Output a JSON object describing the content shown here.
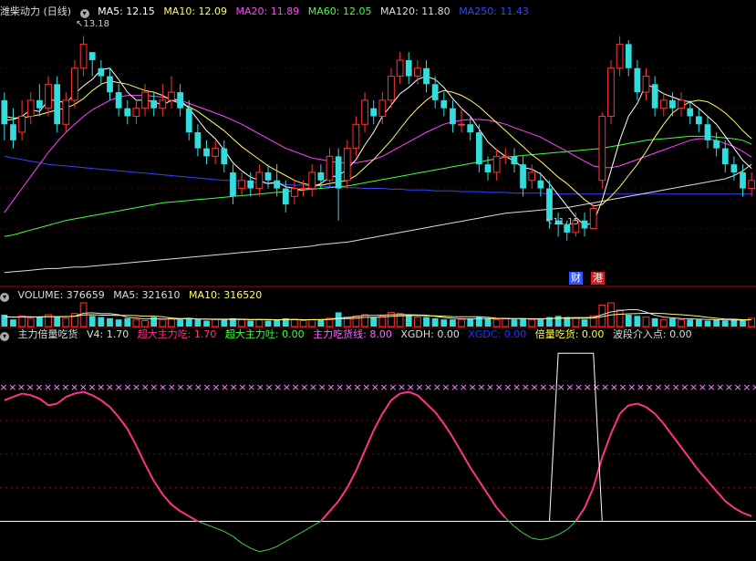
{
  "price_header": {
    "title": "潍柴动力 (日线)",
    "items": [
      {
        "label": "MA5: 12.15",
        "color": "#ffffff"
      },
      {
        "label": "MA10: 12.09",
        "color": "#ffff66"
      },
      {
        "label": "MA20: 11.89",
        "color": "#ff44ff"
      },
      {
        "label": "MA60: 12.05",
        "color": "#44ff44"
      },
      {
        "label": "MA120: 11.80",
        "color": "#dddddd"
      },
      {
        "label": "MA250: 11.43",
        "color": "#3344ff"
      }
    ]
  },
  "volume_header": {
    "title": "VOLUME: 376659",
    "items": [
      {
        "label": "MA5: 321610",
        "color": "#dddddd"
      },
      {
        "label": "MA10: 316520",
        "color": "#ffff66"
      }
    ]
  },
  "indicator_header": {
    "title": "主力倍量吃货",
    "items": [
      {
        "label": "V4: 1.70",
        "color": "#dddddd"
      },
      {
        "label": "超大主力吃: 1.70",
        "color": "#ff3388"
      },
      {
        "label": "超大主力吐: 0.00",
        "color": "#44ff44"
      },
      {
        "label": "主力吃货线: 8.00",
        "color": "#ff66ff"
      },
      {
        "label": "XGDH: 0.00",
        "color": "#dddddd"
      },
      {
        "label": "XGDC: 0.00",
        "color": "#2233ff"
      },
      {
        "label": "倍量吃货: 0.00",
        "color": "#ffff44"
      },
      {
        "label": "波段介入点: 0.00",
        "color": "#dddddd"
      }
    ]
  },
  "annotations": {
    "high": "13.18",
    "low": "11.15"
  },
  "badges": [
    {
      "label": "财",
      "color": "#3355ff"
    },
    {
      "label": "港",
      "color": "#cc2222"
    }
  ],
  "colors": {
    "up": "#ff3333",
    "down": "#33dddd",
    "grid": "#880000"
  },
  "chart_data": {
    "type": "candlestick",
    "price_range": [
      10.3,
      13.6
    ],
    "candles": [
      [
        12.6,
        12.3,
        12.7,
        12.1
      ],
      [
        12.3,
        12.1,
        12.5,
        12.0
      ],
      [
        12.2,
        12.4,
        12.6,
        12.1
      ],
      [
        12.4,
        12.6,
        12.7,
        12.3
      ],
      [
        12.6,
        12.5,
        12.8,
        12.4
      ],
      [
        12.5,
        12.8,
        12.9,
        12.4
      ],
      [
        12.8,
        12.3,
        12.9,
        12.2
      ],
      [
        12.3,
        12.6,
        12.7,
        12.2
      ],
      [
        12.6,
        13.0,
        13.1,
        12.5
      ],
      [
        13.0,
        13.3,
        13.4,
        12.9
      ],
      [
        13.2,
        13.1,
        13.18,
        12.9
      ],
      [
        13.0,
        12.9,
        13.1,
        12.8
      ],
      [
        12.9,
        12.7,
        13.0,
        12.6
      ],
      [
        12.7,
        12.5,
        12.8,
        12.4
      ],
      [
        12.5,
        12.4,
        12.6,
        12.3
      ],
      [
        12.4,
        12.5,
        12.6,
        12.3
      ],
      [
        12.5,
        12.7,
        12.8,
        12.4
      ],
      [
        12.6,
        12.5,
        12.7,
        12.4
      ],
      [
        12.5,
        12.6,
        12.8,
        12.4
      ],
      [
        12.6,
        12.7,
        12.9,
        12.5
      ],
      [
        12.7,
        12.5,
        12.8,
        12.4
      ],
      [
        12.5,
        12.2,
        12.6,
        12.1
      ],
      [
        12.2,
        12.0,
        12.3,
        11.9
      ],
      [
        12.0,
        11.9,
        12.1,
        11.8
      ],
      [
        11.9,
        12.0,
        12.1,
        11.8
      ],
      [
        12.0,
        11.8,
        12.1,
        11.7
      ],
      [
        11.7,
        11.4,
        11.8,
        11.3
      ],
      [
        11.5,
        11.6,
        11.7,
        11.4
      ],
      [
        11.6,
        11.5,
        11.7,
        11.4
      ],
      [
        11.5,
        11.7,
        11.8,
        11.4
      ],
      [
        11.7,
        11.6,
        11.8,
        11.5
      ],
      [
        11.6,
        11.5,
        11.8,
        11.4
      ],
      [
        11.5,
        11.3,
        11.6,
        11.2
      ],
      [
        11.4,
        11.5,
        11.6,
        11.3
      ],
      [
        11.5,
        11.5,
        11.6,
        11.4
      ],
      [
        11.5,
        11.7,
        11.8,
        11.4
      ],
      [
        11.7,
        11.6,
        11.8,
        11.5
      ],
      [
        11.6,
        11.9,
        12.0,
        11.5
      ],
      [
        11.9,
        11.5,
        12.0,
        11.1
      ],
      [
        11.6,
        12.0,
        12.1,
        11.5
      ],
      [
        12.0,
        12.3,
        12.4,
        11.9
      ],
      [
        12.3,
        12.6,
        12.7,
        12.2
      ],
      [
        12.5,
        12.4,
        12.6,
        12.3
      ],
      [
        12.4,
        12.6,
        12.7,
        12.3
      ],
      [
        12.6,
        12.9,
        13.0,
        12.5
      ],
      [
        12.9,
        13.1,
        13.2,
        12.8
      ],
      [
        13.1,
        12.9,
        13.2,
        12.8
      ],
      [
        12.9,
        13.0,
        13.1,
        12.8
      ],
      [
        13.0,
        12.8,
        13.1,
        12.7
      ],
      [
        12.8,
        12.6,
        12.9,
        12.5
      ],
      [
        12.6,
        12.5,
        12.7,
        12.4
      ],
      [
        12.5,
        12.3,
        12.6,
        12.2
      ],
      [
        12.3,
        12.3,
        12.5,
        12.2
      ],
      [
        12.3,
        12.2,
        12.4,
        12.1
      ],
      [
        12.2,
        11.8,
        12.3,
        11.7
      ],
      [
        11.8,
        11.7,
        11.9,
        11.6
      ],
      [
        11.7,
        11.9,
        12.0,
        11.6
      ],
      [
        11.9,
        11.9,
        12.0,
        11.8
      ],
      [
        11.9,
        11.8,
        12.0,
        11.7
      ],
      [
        11.8,
        11.5,
        11.9,
        11.4
      ],
      [
        11.6,
        11.7,
        11.8,
        11.5
      ],
      [
        11.6,
        11.5,
        11.7,
        11.4
      ],
      [
        11.5,
        11.1,
        11.6,
        11.0
      ],
      [
        11.1,
        11.05,
        11.2,
        10.9
      ],
      [
        11.05,
        10.95,
        11.1,
        10.85
      ],
      [
        10.95,
        11.1,
        11.2,
        10.9
      ],
      [
        11.1,
        11.0,
        11.2,
        10.9
      ],
      [
        11.0,
        11.25,
        11.3,
        11.0
      ],
      [
        11.6,
        12.4,
        12.45,
        11.5
      ],
      [
        12.4,
        13.0,
        13.1,
        12.3
      ],
      [
        13.0,
        13.3,
        13.4,
        12.9
      ],
      [
        13.3,
        13.0,
        13.35,
        12.9
      ],
      [
        13.0,
        12.7,
        13.1,
        12.6
      ],
      [
        12.7,
        12.9,
        13.0,
        12.6
      ],
      [
        12.8,
        12.5,
        12.9,
        12.4
      ],
      [
        12.5,
        12.6,
        12.7,
        12.4
      ],
      [
        12.6,
        12.5,
        12.7,
        12.4
      ],
      [
        12.5,
        12.6,
        12.7,
        12.4
      ],
      [
        12.5,
        12.4,
        12.6,
        12.3
      ],
      [
        12.4,
        12.3,
        12.5,
        12.2
      ],
      [
        12.3,
        12.1,
        12.4,
        12.0
      ],
      [
        12.1,
        12.0,
        12.2,
        11.9
      ],
      [
        12.0,
        11.8,
        12.1,
        11.7
      ],
      [
        11.8,
        11.7,
        11.9,
        11.6
      ],
      [
        11.7,
        11.5,
        11.8,
        11.4
      ],
      [
        11.5,
        11.6,
        11.7,
        11.4
      ]
    ],
    "ma5": [
      12.35,
      12.36,
      12.4,
      12.48,
      12.46,
      12.6,
      12.6,
      12.56,
      12.68,
      12.78,
      12.86,
      12.98,
      13.0,
      12.86,
      12.7,
      12.6,
      12.6,
      12.58,
      12.54,
      12.6,
      12.6,
      12.5,
      12.36,
      12.22,
      12.12,
      11.98,
      11.82,
      11.72,
      11.64,
      11.6,
      11.56,
      11.58,
      11.52,
      11.5,
      11.48,
      11.52,
      11.56,
      11.64,
      11.66,
      11.74,
      11.86,
      12.04,
      12.2,
      12.4,
      12.54,
      12.68,
      12.76,
      12.86,
      12.9,
      12.86,
      12.76,
      12.62,
      12.5,
      12.4,
      12.24,
      12.08,
      11.98,
      11.9,
      11.84,
      11.76,
      11.74,
      11.68,
      11.56,
      11.42,
      11.28,
      11.14,
      11.04,
      11.07,
      11.35,
      11.72,
      12.1,
      12.4,
      12.56,
      12.8,
      12.75,
      12.68,
      12.64,
      12.6,
      12.58,
      12.5,
      12.4,
      12.3,
      12.15,
      12.0,
      11.85,
      11.75
    ],
    "ma10": [
      12.4,
      12.38,
      12.38,
      12.4,
      12.42,
      12.45,
      12.48,
      12.5,
      12.55,
      12.62,
      12.72,
      12.8,
      12.84,
      12.82,
      12.8,
      12.76,
      12.72,
      12.7,
      12.66,
      12.6,
      12.56,
      12.52,
      12.46,
      12.38,
      12.3,
      12.22,
      12.12,
      12.02,
      11.94,
      11.86,
      11.78,
      11.72,
      11.66,
      11.6,
      11.56,
      11.54,
      11.54,
      11.56,
      11.58,
      11.6,
      11.66,
      11.76,
      11.86,
      11.98,
      12.1,
      12.24,
      12.38,
      12.5,
      12.6,
      12.68,
      12.72,
      12.7,
      12.66,
      12.6,
      12.52,
      12.42,
      12.32,
      12.22,
      12.12,
      12.02,
      11.92,
      11.84,
      11.74,
      11.64,
      11.56,
      11.46,
      11.36,
      11.28,
      11.3,
      11.4,
      11.52,
      11.66,
      11.8,
      11.96,
      12.14,
      12.3,
      12.44,
      12.52,
      12.58,
      12.6,
      12.58,
      12.52,
      12.44,
      12.34,
      12.22,
      12.12
    ],
    "ma20": [
      11.2,
      11.35,
      11.5,
      11.65,
      11.8,
      11.95,
      12.08,
      12.2,
      12.3,
      12.4,
      12.48,
      12.54,
      12.6,
      12.64,
      12.66,
      12.66,
      12.66,
      12.65,
      12.64,
      12.62,
      12.6,
      12.56,
      12.52,
      12.48,
      12.44,
      12.4,
      12.35,
      12.3,
      12.24,
      12.18,
      12.12,
      12.06,
      12.0,
      11.96,
      11.92,
      11.88,
      11.86,
      11.84,
      11.82,
      11.82,
      11.82,
      11.84,
      11.86,
      11.9,
      11.96,
      12.02,
      12.08,
      12.14,
      12.2,
      12.25,
      12.3,
      12.33,
      12.35,
      12.36,
      12.36,
      12.35,
      12.33,
      12.3,
      12.26,
      12.22,
      12.18,
      12.14,
      12.08,
      12.02,
      11.96,
      11.9,
      11.84,
      11.78,
      11.76,
      11.76,
      11.78,
      11.82,
      11.86,
      11.9,
      11.94,
      11.98,
      12.02,
      12.06,
      12.1,
      12.12,
      12.12,
      12.1,
      12.06,
      12.02,
      11.96,
      11.89
    ],
    "ma60": [
      10.9,
      10.92,
      10.95,
      10.98,
      11.01,
      11.04,
      11.07,
      11.1,
      11.12,
      11.14,
      11.16,
      11.18,
      11.2,
      11.22,
      11.24,
      11.26,
      11.28,
      11.3,
      11.32,
      11.33,
      11.34,
      11.35,
      11.36,
      11.37,
      11.38,
      11.39,
      11.4,
      11.41,
      11.42,
      11.43,
      11.44,
      11.45,
      11.46,
      11.47,
      11.48,
      11.49,
      11.5,
      11.51,
      11.52,
      11.53,
      11.55,
      11.57,
      11.59,
      11.61,
      11.63,
      11.65,
      11.67,
      11.69,
      11.71,
      11.73,
      11.75,
      11.77,
      11.79,
      11.81,
      11.83,
      11.85,
      11.87,
      11.89,
      11.9,
      11.91,
      11.92,
      11.93,
      11.94,
      11.95,
      11.96,
      11.97,
      11.98,
      11.99,
      12.0,
      12.02,
      12.04,
      12.06,
      12.08,
      12.1,
      12.11,
      12.12,
      12.13,
      12.14,
      12.15,
      12.15,
      12.15,
      12.14,
      12.13,
      12.12,
      12.1,
      12.05
    ],
    "ma120": [
      10.45,
      10.46,
      10.47,
      10.48,
      10.49,
      10.5,
      10.5,
      10.51,
      10.52,
      10.52,
      10.53,
      10.54,
      10.55,
      10.56,
      10.57,
      10.58,
      10.59,
      10.6,
      10.61,
      10.62,
      10.63,
      10.64,
      10.65,
      10.66,
      10.67,
      10.68,
      10.69,
      10.7,
      10.71,
      10.72,
      10.73,
      10.74,
      10.75,
      10.76,
      10.77,
      10.78,
      10.8,
      10.81,
      10.82,
      10.83,
      10.85,
      10.87,
      10.89,
      10.91,
      10.93,
      10.95,
      10.97,
      10.99,
      11.01,
      11.03,
      11.05,
      11.07,
      11.09,
      11.11,
      11.13,
      11.15,
      11.17,
      11.19,
      11.2,
      11.21,
      11.22,
      11.23,
      11.24,
      11.25,
      11.26,
      11.28,
      11.3,
      11.32,
      11.34,
      11.36,
      11.38,
      11.4,
      11.42,
      11.44,
      11.46,
      11.48,
      11.5,
      11.52,
      11.54,
      11.56,
      11.58,
      11.6,
      11.62,
      11.66,
      11.72,
      11.8
    ],
    "ma250": [
      11.9,
      11.88,
      11.86,
      11.84,
      11.82,
      11.8,
      11.79,
      11.78,
      11.77,
      11.76,
      11.75,
      11.74,
      11.73,
      11.72,
      11.71,
      11.7,
      11.69,
      11.68,
      11.67,
      11.66,
      11.65,
      11.64,
      11.63,
      11.62,
      11.61,
      11.6,
      11.6,
      11.59,
      11.58,
      11.57,
      11.56,
      11.56,
      11.55,
      11.54,
      11.54,
      11.53,
      11.53,
      11.52,
      11.52,
      11.51,
      11.51,
      11.5,
      11.5,
      11.5,
      11.49,
      11.49,
      11.48,
      11.48,
      11.48,
      11.47,
      11.47,
      11.47,
      11.46,
      11.46,
      11.46,
      11.45,
      11.45,
      11.45,
      11.44,
      11.44,
      11.44,
      11.44,
      11.43,
      11.43,
      11.43,
      11.43,
      11.43,
      11.43,
      11.43,
      11.43,
      11.43,
      11.43,
      11.43,
      11.43,
      11.43,
      11.43,
      11.43,
      11.43,
      11.43,
      11.43,
      11.43,
      11.43,
      11.43,
      11.43,
      11.43,
      11.43
    ],
    "volume": [
      0.5,
      0.3,
      0.45,
      0.35,
      0.4,
      0.5,
      0.4,
      0.35,
      0.55,
      1.0,
      0.45,
      0.4,
      0.35,
      0.3,
      0.35,
      0.3,
      0.25,
      0.4,
      0.3,
      0.35,
      0.3,
      0.35,
      0.3,
      0.25,
      0.3,
      0.3,
      0.35,
      0.3,
      0.25,
      0.3,
      0.25,
      0.3,
      0.35,
      0.3,
      0.25,
      0.3,
      0.3,
      0.35,
      0.6,
      0.4,
      0.45,
      0.5,
      0.4,
      0.45,
      0.6,
      0.55,
      0.45,
      0.4,
      0.4,
      0.35,
      0.3,
      0.3,
      0.3,
      0.35,
      0.4,
      0.35,
      0.3,
      0.35,
      0.3,
      0.35,
      0.3,
      0.3,
      0.4,
      0.45,
      0.4,
      0.35,
      0.3,
      0.45,
      0.9,
      1.0,
      0.7,
      0.5,
      0.45,
      0.4,
      0.35,
      0.3,
      0.35,
      0.3,
      0.3,
      0.3,
      0.25,
      0.3,
      0.25,
      0.3,
      0.25,
      0.35
    ],
    "vol_ma5": [
      0.42,
      0.4,
      0.41,
      0.41,
      0.4,
      0.42,
      0.42,
      0.42,
      0.44,
      0.56,
      0.58,
      0.55,
      0.55,
      0.5,
      0.39,
      0.36,
      0.32,
      0.33,
      0.32,
      0.32,
      0.32,
      0.34,
      0.32,
      0.31,
      0.3,
      0.3,
      0.3,
      0.3,
      0.29,
      0.3,
      0.29,
      0.28,
      0.29,
      0.3,
      0.29,
      0.29,
      0.3,
      0.31,
      0.36,
      0.38,
      0.42,
      0.47,
      0.47,
      0.48,
      0.5,
      0.51,
      0.5,
      0.49,
      0.48,
      0.43,
      0.38,
      0.35,
      0.33,
      0.32,
      0.33,
      0.34,
      0.34,
      0.34,
      0.34,
      0.34,
      0.32,
      0.32,
      0.34,
      0.36,
      0.37,
      0.38,
      0.38,
      0.39,
      0.5,
      0.62,
      0.67,
      0.71,
      0.71,
      0.61,
      0.48,
      0.4,
      0.37,
      0.34,
      0.33,
      0.31,
      0.3,
      0.29,
      0.28,
      0.28,
      0.27,
      0.29
    ],
    "vol_ma10": [
      0.4,
      0.4,
      0.4,
      0.4,
      0.41,
      0.41,
      0.41,
      0.42,
      0.43,
      0.49,
      0.5,
      0.48,
      0.48,
      0.47,
      0.47,
      0.46,
      0.44,
      0.44,
      0.41,
      0.36,
      0.34,
      0.35,
      0.32,
      0.32,
      0.31,
      0.31,
      0.32,
      0.31,
      0.3,
      0.3,
      0.3,
      0.29,
      0.3,
      0.3,
      0.29,
      0.29,
      0.29,
      0.3,
      0.33,
      0.34,
      0.35,
      0.39,
      0.39,
      0.4,
      0.43,
      0.45,
      0.46,
      0.47,
      0.45,
      0.45,
      0.44,
      0.42,
      0.41,
      0.41,
      0.41,
      0.39,
      0.35,
      0.34,
      0.33,
      0.33,
      0.33,
      0.33,
      0.34,
      0.35,
      0.35,
      0.35,
      0.35,
      0.36,
      0.42,
      0.49,
      0.52,
      0.54,
      0.55,
      0.56,
      0.56,
      0.55,
      0.52,
      0.5,
      0.47,
      0.44,
      0.39,
      0.35,
      0.32,
      0.31,
      0.29,
      0.29
    ],
    "indicator_range": [
      -2.2,
      10.5
    ],
    "chi_huo_line": 8.0,
    "oscillator": [
      7.2,
      7.4,
      7.6,
      7.5,
      7.3,
      6.9,
      7.0,
      7.4,
      7.6,
      7.7,
      7.5,
      7.2,
      6.8,
      6.2,
      5.5,
      4.5,
      3.4,
      2.4,
      1.6,
      1.0,
      0.6,
      0.3,
      0.0,
      -0.2,
      -0.4,
      -0.6,
      -0.9,
      -1.3,
      -1.6,
      -1.8,
      -1.7,
      -1.5,
      -1.2,
      -0.9,
      -0.6,
      -0.3,
      0.0,
      0.6,
      1.2,
      2.0,
      3.0,
      4.2,
      5.4,
      6.4,
      7.2,
      7.6,
      7.7,
      7.5,
      7.0,
      6.5,
      5.8,
      5.0,
      4.1,
      3.2,
      2.4,
      1.6,
      0.8,
      0.2,
      -0.3,
      -0.7,
      -1.0,
      -1.1,
      -1.0,
      -0.8,
      -0.5,
      0.0,
      0.8,
      2.0,
      3.8,
      5.2,
      6.4,
      6.9,
      7.0,
      6.8,
      6.4,
      5.8,
      5.1,
      4.4,
      3.7,
      3.0,
      2.4,
      1.8,
      1.2,
      0.8,
      0.5,
      0.3
    ],
    "bei_liang_pulse": [
      63,
      67,
      10.0
    ]
  }
}
